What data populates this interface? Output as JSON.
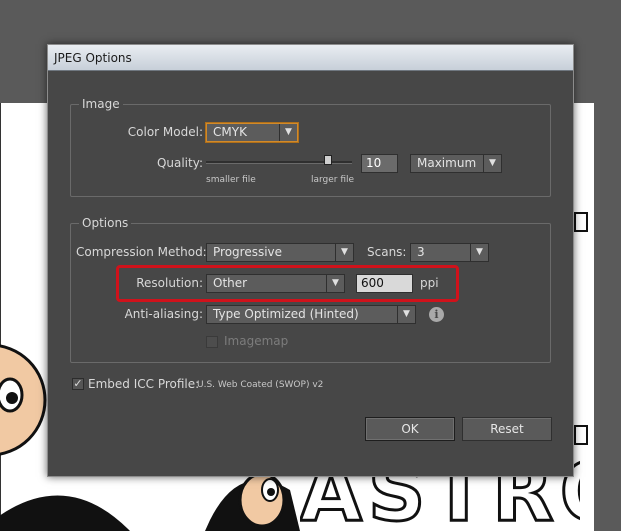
{
  "window": {
    "title": "JPEG Options"
  },
  "image_group": {
    "title": "Image",
    "color_model_label": "Color Model:",
    "color_model_value": "CMYK",
    "quality_label": "Quality:",
    "quality_value": "10",
    "quality_preset": "Maximum",
    "quality_level": 10,
    "smaller_label": "smaller file",
    "larger_label": "larger file"
  },
  "options_group": {
    "title": "Options",
    "compression_label": "Compression Method:",
    "compression_value": "Progressive",
    "scans_label": "Scans:",
    "scans_value": "3",
    "resolution_label": "Resolution:",
    "resolution_value": "Other",
    "resolution_number": "600",
    "resolution_unit": "ppi",
    "antialiasing_label": "Anti-aliasing:",
    "antialiasing_value": "Type Optimized (Hinted)",
    "info_glyph": "i",
    "imagemap_label": "Imagemap",
    "imagemap_checked": false
  },
  "embed_icc": {
    "label": "Embed ICC Profile:",
    "profile": "U.S. Web Coated (SWOP) v2",
    "checked": true,
    "check_glyph": "✓"
  },
  "buttons": {
    "ok": "OK",
    "cancel": "Reset"
  },
  "colors": {
    "dialog_bg": "#474747",
    "focus_accent": "#d18a2a",
    "highlight_red": "#d0121b"
  },
  "icons": {
    "dropdown": "chevron-down-icon",
    "info": "info-icon",
    "check": "checkmark-icon"
  }
}
